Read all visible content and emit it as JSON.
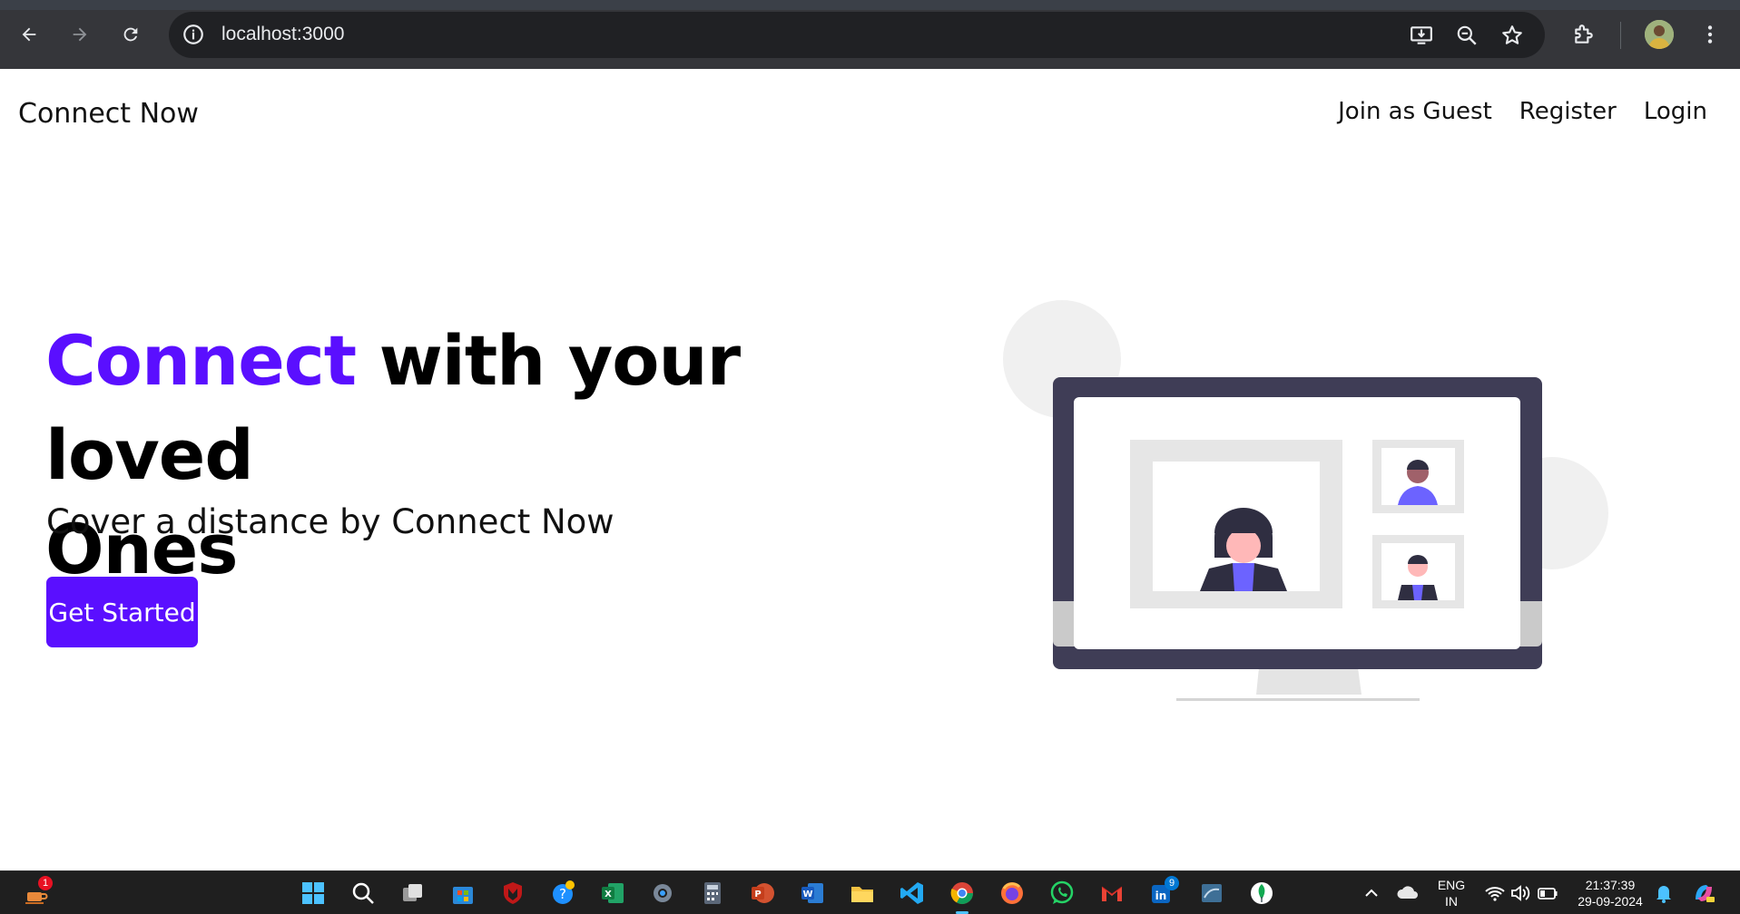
{
  "browser": {
    "url": "localhost:3000",
    "nav": {
      "back": "arrow-left-icon",
      "forward": "arrow-right-icon",
      "reload": "reload-icon"
    }
  },
  "site": {
    "brand": "Connect Now",
    "nav": [
      "Join as Guest",
      "Register",
      "Login"
    ],
    "hero": {
      "title_accent": "Connect",
      "title_rest_line1": " with your loved",
      "title_line2": "Ones",
      "subtitle": "Cover a distance by Connect Now",
      "cta": "Get Started"
    },
    "colors": {
      "accent": "#5a0fff",
      "monitor": "#3f3d56",
      "figure_purple": "#6c63ff"
    }
  },
  "taskbar": {
    "left_badge": "1",
    "linkedin_badge": "9",
    "lang_top": "ENG",
    "lang_bottom": "IN",
    "time": "21:37:39",
    "date": "29-09-2024"
  }
}
